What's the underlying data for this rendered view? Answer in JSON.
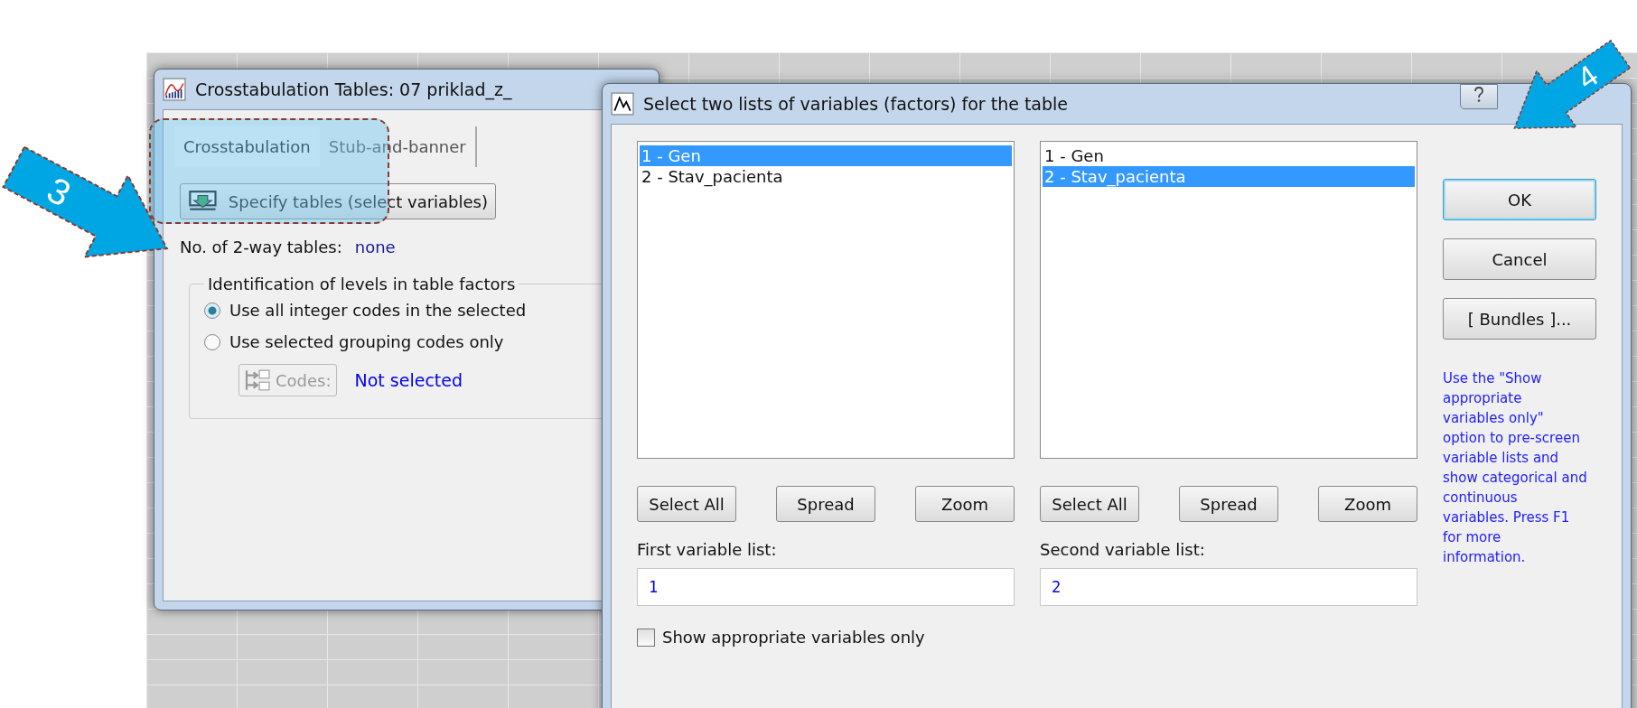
{
  "crosstab_dialog": {
    "title": "Crosstabulation Tables: 07 priklad_z_",
    "tabs": [
      {
        "label": "Crosstabulation",
        "selected": true
      },
      {
        "label": "Stub-and-banner",
        "selected": false
      }
    ],
    "specify_button": "Specify tables (select variables)",
    "tables_label": "No. of 2-way tables:",
    "tables_value": "none",
    "group": {
      "title": "Identification of levels in table factors",
      "options": [
        {
          "label": "Use all integer codes in the selected",
          "selected": true
        },
        {
          "label": "Use selected grouping codes only",
          "selected": false
        }
      ],
      "codes_button": {
        "label": "Codes:",
        "disabled": true
      },
      "codes_value": "Not selected"
    }
  },
  "select_dialog": {
    "title": "Select two lists of variables (factors) for the table",
    "lists": [
      {
        "items": [
          {
            "label": "1 - Gen",
            "selected": true
          },
          {
            "label": "2 - Stav_pacienta",
            "selected": false
          }
        ],
        "buttons": [
          "Select All",
          "Spread",
          "Zoom"
        ],
        "field_label": "First variable list:",
        "value": "1"
      },
      {
        "items": [
          {
            "label": "1 - Gen",
            "selected": false
          },
          {
            "label": "2 - Stav_pacienta",
            "selected": true
          }
        ],
        "buttons": [
          "Select All",
          "Spread",
          "Zoom"
        ],
        "field_label": "Second variable list:",
        "value": "2"
      }
    ],
    "checkbox": {
      "label": "Show appropriate variables only",
      "checked": false
    },
    "buttons": [
      "OK",
      "Cancel",
      "[ Bundles ]..."
    ],
    "help": "Use the \"Show appropriate variables only\" option to pre-screen variable lists and show categorical and continuous variables. Press F1 for more information."
  },
  "annotations": [
    {
      "label": "3"
    },
    {
      "label": "4"
    }
  ]
}
